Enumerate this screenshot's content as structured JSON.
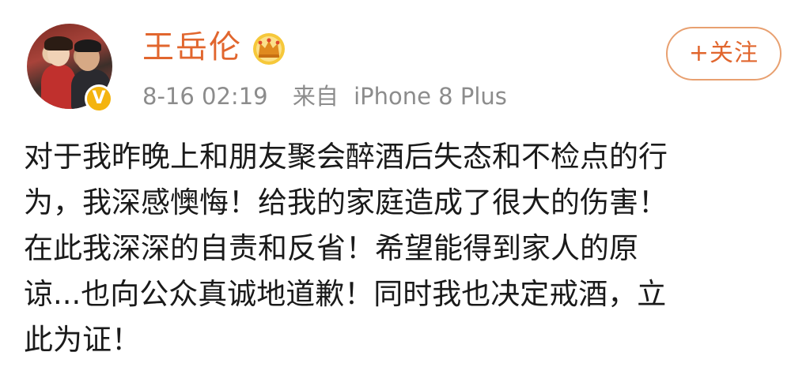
{
  "user": {
    "name": "王岳伦",
    "verified": true,
    "verified_color": "#f4b40f",
    "name_color": "#e1662e",
    "badge_icon": "crown-icon"
  },
  "meta": {
    "time": "8-16 02:19",
    "source_prefix": "来自",
    "source": "iPhone 8 Plus"
  },
  "follow_button": {
    "label": "+关注"
  },
  "post": {
    "lines": [
      "对于我昨晚上和朋友聚会醉酒后失态和不检点的行",
      "为，我深感懊悔！给我的家庭造成了很大的伤害！",
      "在此我深深的自责和反省！希望能得到家人的原",
      "谅...也向公众真诚地道歉！同时我也决定戒酒，立",
      "此为证！"
    ]
  }
}
